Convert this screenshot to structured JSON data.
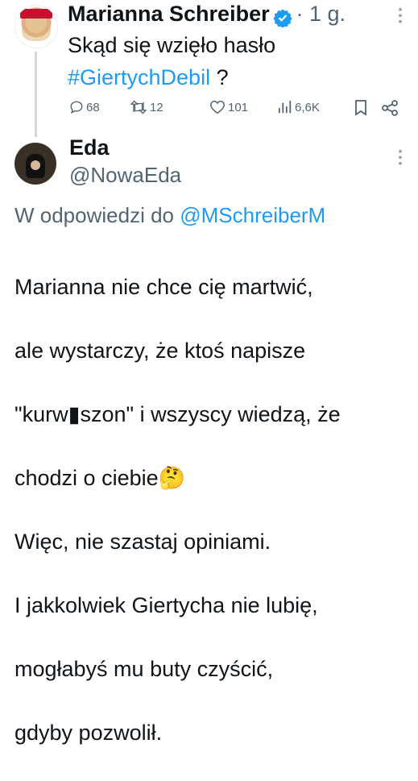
{
  "tweet1": {
    "author_name": "Marianna Schreiber",
    "time": "· 1 g.",
    "text_line1": "Skąd się wzięło hasło",
    "hashtag": "#GiertychDebil",
    "text_after_hashtag": "?",
    "stats": {
      "replies": "68",
      "retweets": "12",
      "likes": "101",
      "views": "6,6K"
    }
  },
  "tweet2": {
    "author_name": "Eda",
    "handle": "@NowaEda",
    "reply_prefix": "W odpowiedzi do",
    "reply_handle": "@MSchreiberM",
    "lines": [
      "Marianna nie chce cię martwić,",
      "ale wystarczy, że ktoś napisze",
      "\"kurw▮szon\" i wszyscy wiedzą, że",
      "chodzi o ciebie🤔",
      "Więc, nie szastaj opiniami.",
      "I jakkolwiek Giertycha nie lubię,",
      "mogłabyś mu buty czyścić,",
      "gdyby pozwolił."
    ]
  },
  "colors": {
    "accent": "#1d9bf0",
    "muted": "#536471",
    "text": "#0f1419"
  },
  "icons": [
    "reply-icon",
    "retweet-icon",
    "like-icon",
    "views-icon",
    "bookmark-icon",
    "share-icon",
    "verified-icon",
    "more-icon"
  ]
}
